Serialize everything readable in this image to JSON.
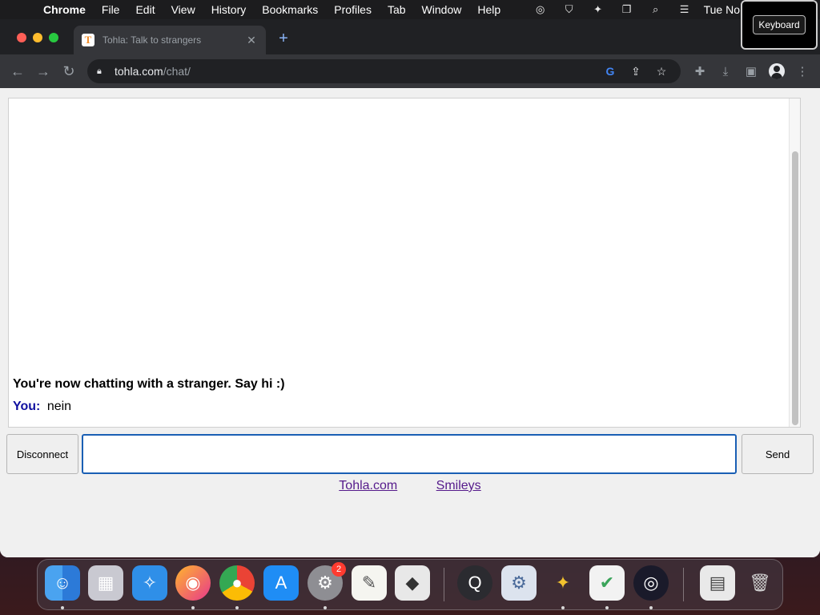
{
  "menubar": {
    "app_name": "Chrome",
    "items": [
      "File",
      "Edit",
      "View",
      "History",
      "Bookmarks",
      "Profiles",
      "Tab",
      "Window",
      "Help"
    ],
    "clock": "Tue No",
    "status_icons": [
      "obs-icon",
      "brave-shield-icon",
      "bee-icon",
      "screens-icon",
      "spotlight-search-icon",
      "control-center-icon"
    ]
  },
  "keyboard_popup": {
    "label": "Keyboard"
  },
  "browser": {
    "tab": {
      "favicon_letter": "T",
      "title": "Tohla: Talk to strangers",
      "close": "✕"
    },
    "new_tab": "+",
    "url": {
      "host": "tohla.com",
      "path": "/chat/"
    }
  },
  "chat": {
    "system_message": "You're now chatting with a stranger. Say hi :)",
    "messages": [
      {
        "sender": "You:",
        "text": "nein"
      }
    ],
    "input": {
      "value": "",
      "placeholder": ""
    },
    "disconnect_label": "Disconnect",
    "send_label": "Send"
  },
  "footer_links": [
    "Tohla.com",
    "Smileys"
  ],
  "dock": {
    "badge_count": "2",
    "apps": [
      "finder",
      "launchpad",
      "safari",
      "firefox",
      "chrome",
      "app-store",
      "system-preferences",
      "textedit",
      "roblox",
      "quicktime",
      "settings",
      "bee",
      "adguard",
      "obs",
      "notes-document",
      "trash"
    ]
  },
  "colors": {
    "you_label": "#1010a0",
    "link": "#551a8b",
    "input_focus_border": "#1a5fb4",
    "browser_chrome": "#35363a"
  }
}
